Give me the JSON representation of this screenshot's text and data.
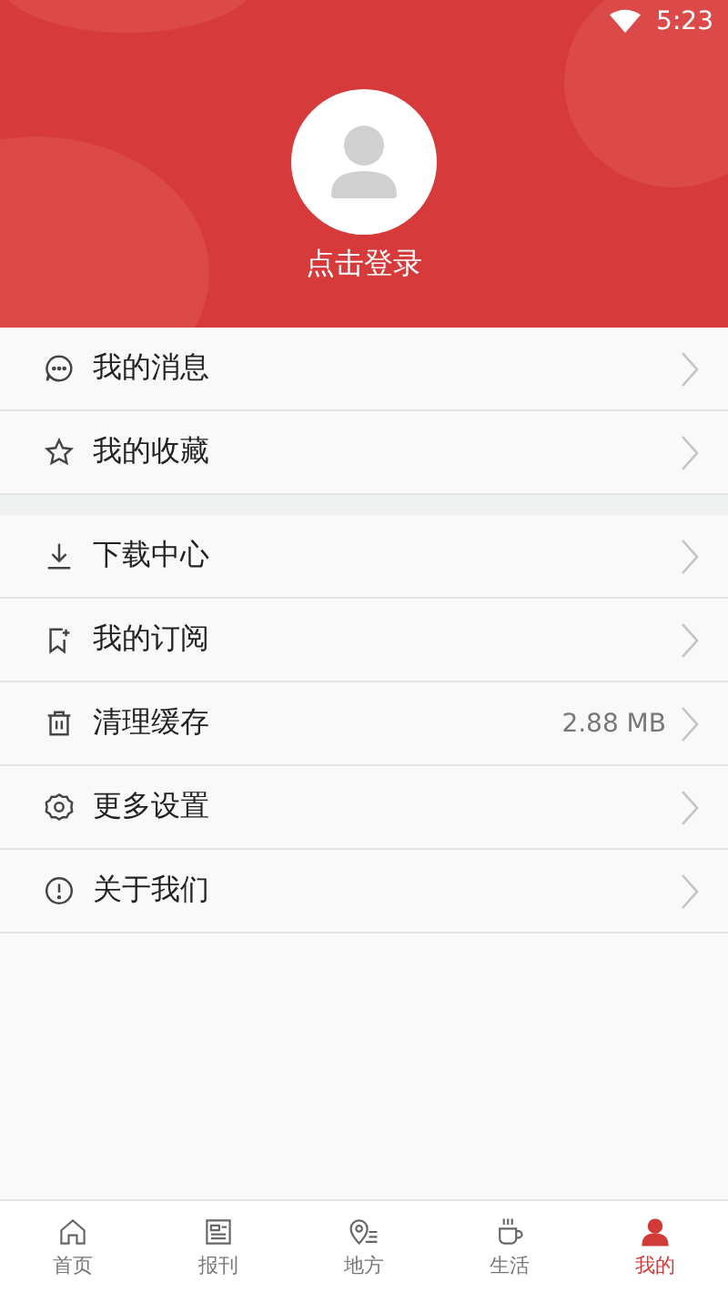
{
  "status_bar": {
    "time": "5:23"
  },
  "profile": {
    "login_label": "点击登录"
  },
  "menu_groups": [
    {
      "items": [
        {
          "kind": "message",
          "label": "我的消息"
        },
        {
          "kind": "star",
          "label": "我的收藏"
        }
      ]
    },
    {
      "items": [
        {
          "kind": "download",
          "label": "下载中心"
        },
        {
          "kind": "subscribe",
          "label": "我的订阅"
        },
        {
          "kind": "trash",
          "label": "清理缓存",
          "value": "2.88 MB"
        },
        {
          "kind": "settings",
          "label": "更多设置"
        },
        {
          "kind": "info",
          "label": "关于我们"
        }
      ]
    }
  ],
  "tabs": [
    {
      "kind": "home",
      "label": "首页",
      "selected": false
    },
    {
      "kind": "newspaper",
      "label": "报刊",
      "selected": false
    },
    {
      "kind": "location",
      "label": "地方",
      "selected": false
    },
    {
      "kind": "cup",
      "label": "生活",
      "selected": false
    },
    {
      "kind": "person",
      "label": "我的",
      "selected": true
    }
  ]
}
